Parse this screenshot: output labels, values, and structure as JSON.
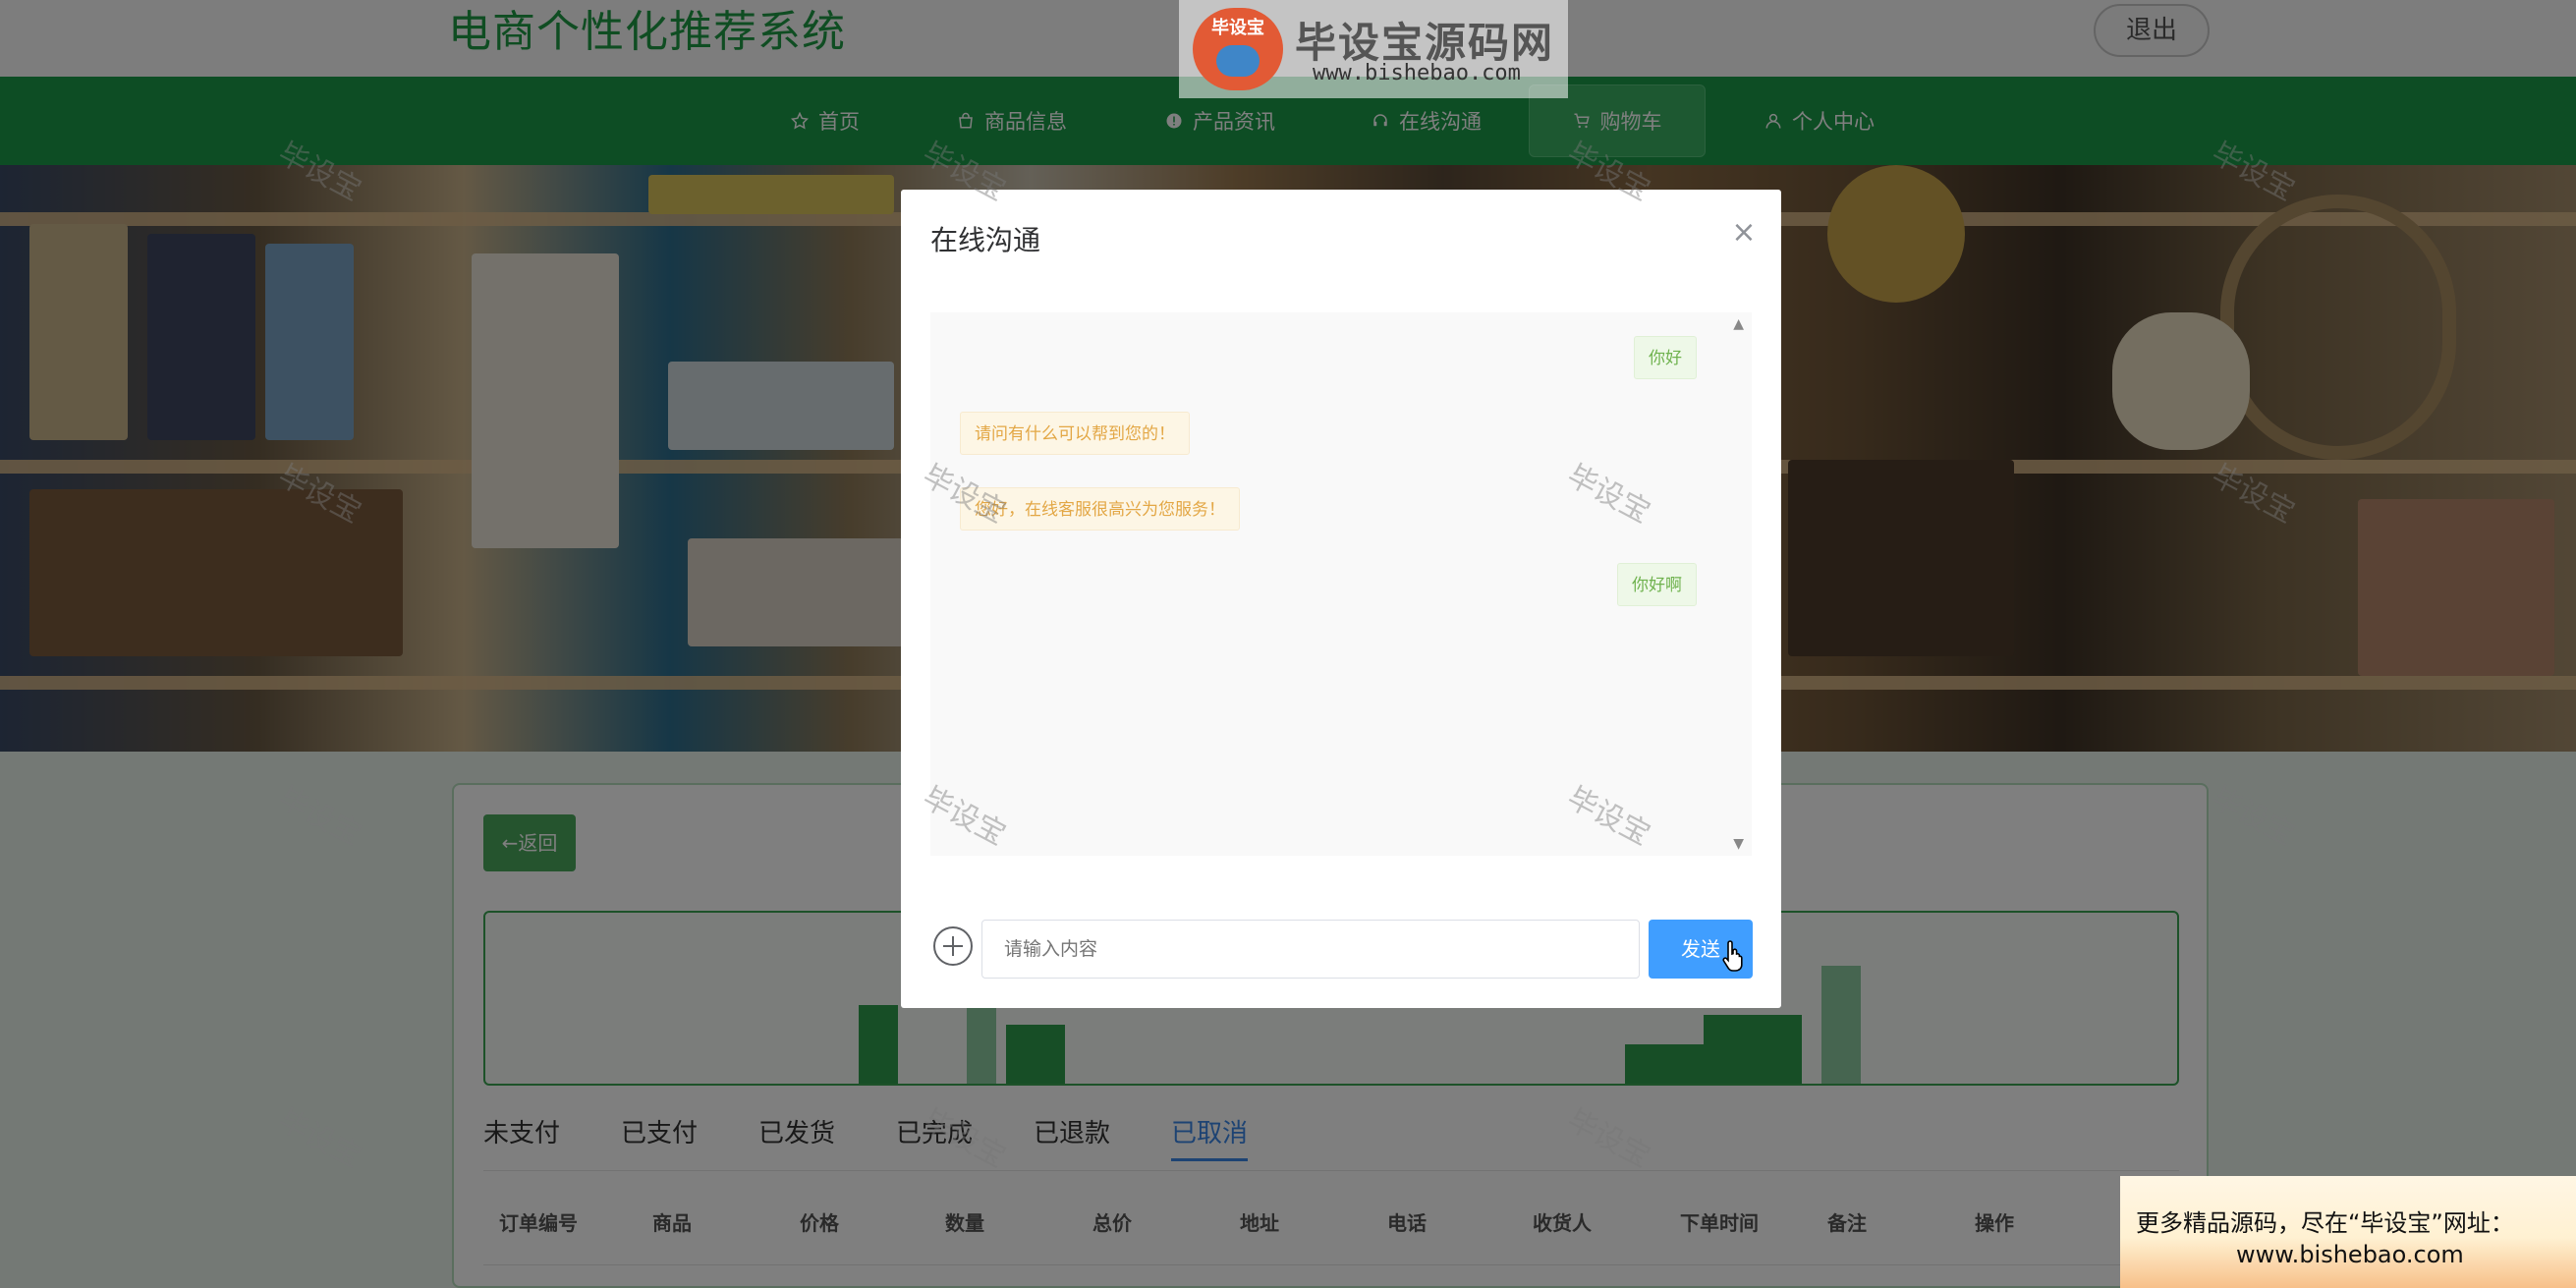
{
  "header": {
    "site_title": "电商个性化推荐系统",
    "logout_label": "退出"
  },
  "nav": {
    "items": [
      {
        "label": "首页",
        "icon": "star-icon"
      },
      {
        "label": "商品信息",
        "icon": "bag-icon"
      },
      {
        "label": "产品资讯",
        "icon": "info-icon"
      },
      {
        "label": "在线沟通",
        "icon": "headset-icon"
      },
      {
        "label": "购物车",
        "icon": "cart-icon"
      },
      {
        "label": "个人中心",
        "icon": "user-icon"
      }
    ],
    "active_index": 4
  },
  "content": {
    "back_label": "←返回",
    "tabs": [
      "未支付",
      "已支付",
      "已发货",
      "已完成",
      "已退款",
      "已取消"
    ],
    "active_tab": 5,
    "columns": [
      "订单编号",
      "商品",
      "价格",
      "数量",
      "总价",
      "地址",
      "电话",
      "收货人",
      "下单时间",
      "备注",
      "操作"
    ]
  },
  "dialog": {
    "title": "在线沟通",
    "messages": [
      {
        "side": "right",
        "text": "你好"
      },
      {
        "side": "left",
        "text": "请问有什么可以帮到您的！"
      },
      {
        "side": "left",
        "text": "您好，在线客服很高兴为您服务！"
      },
      {
        "side": "right",
        "text": "你好啊"
      }
    ],
    "input_placeholder": "请输入内容",
    "send_label": "发送"
  },
  "watermark": {
    "text": "毕设宝",
    "logo_title": "毕设宝源码网",
    "logo_url": "www.bishebao.com",
    "logo_badge": "毕设宝"
  },
  "promo": {
    "line1": "更多精品源码，尽在“毕设宝”网址：",
    "line2": "www.bishebao.com"
  },
  "colors": {
    "primary_green": "#1b9b48",
    "accent_blue": "#409eff",
    "reply_orange": "#e3a745",
    "user_green": "#6fb24e"
  }
}
